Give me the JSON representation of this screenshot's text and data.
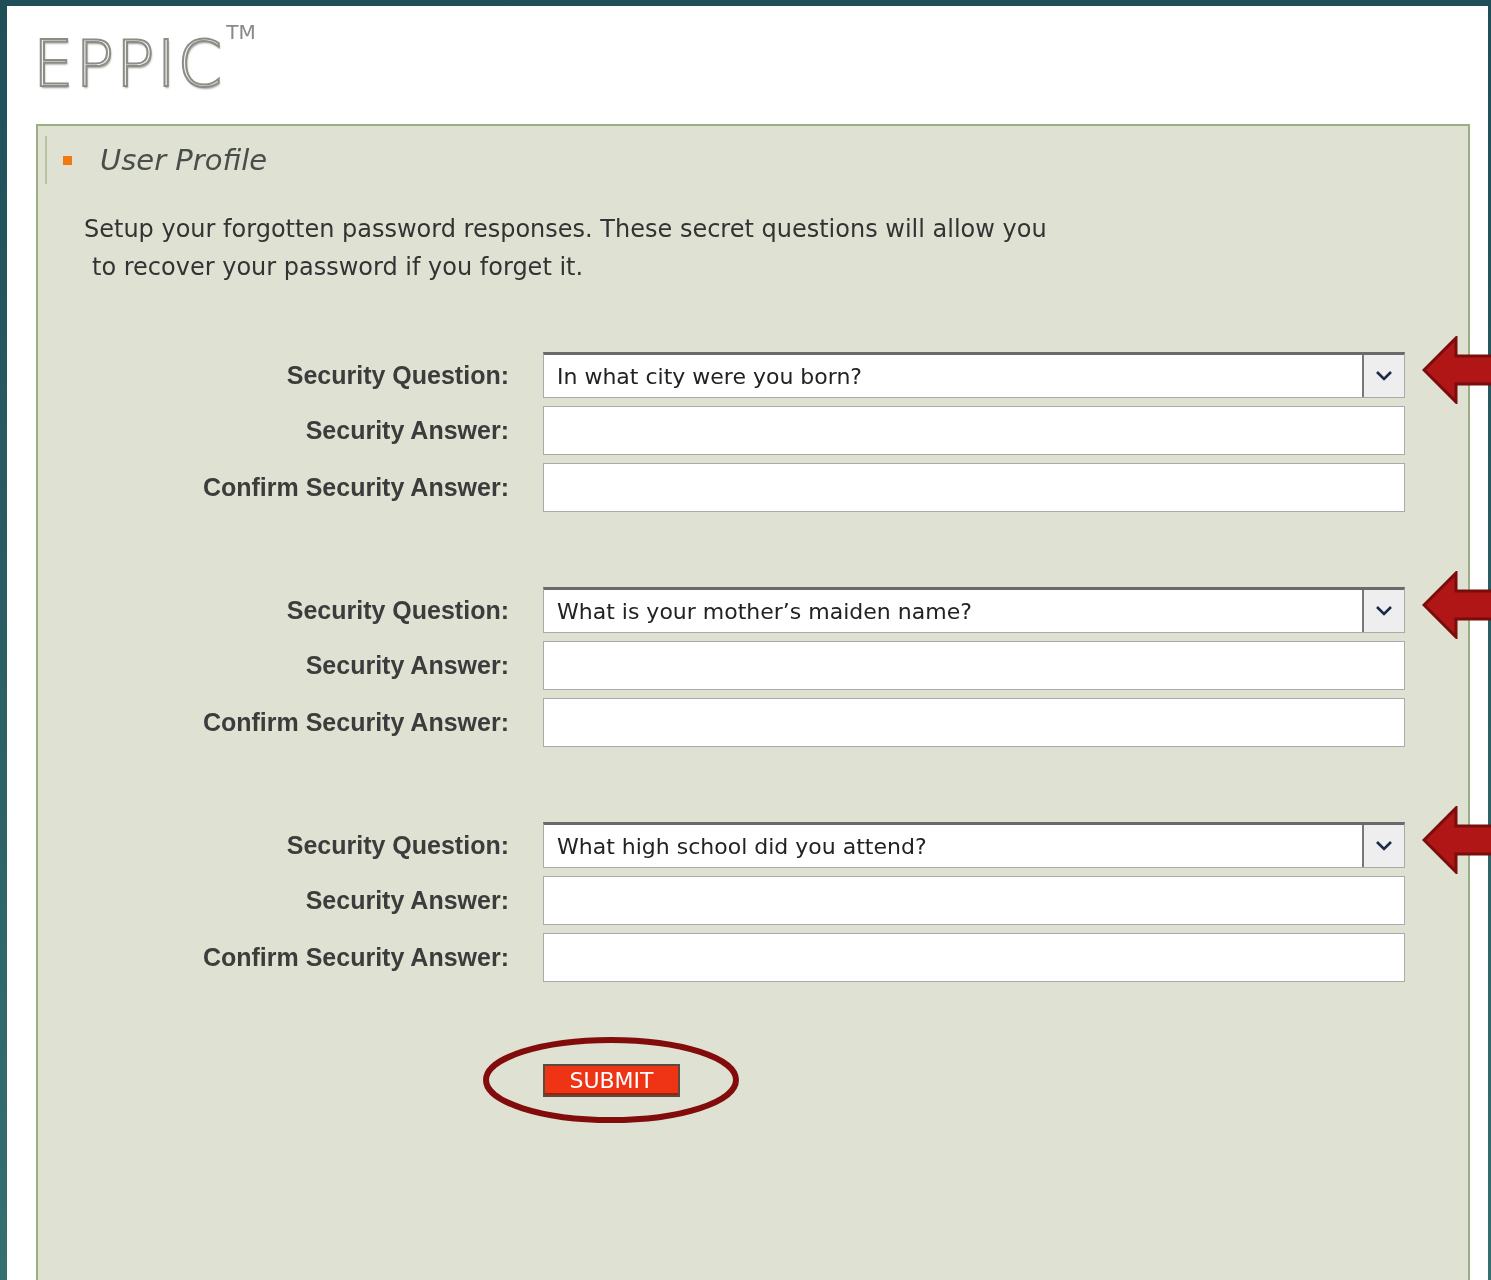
{
  "logo": {
    "text": "EPPIC",
    "mark": "TM"
  },
  "panel": {
    "title": "User Profile",
    "description": [
      "Setup your forgotten password responses. These secret questions will allow you",
      "to recover your password if you forget it."
    ]
  },
  "groups": [
    {
      "question_label": "Security Question:",
      "question": "In what city were you born?",
      "answer_label": "Security Answer:",
      "confirm_label": "Confirm Security Answer:",
      "highlighted": true
    },
    {
      "question_label": "Security Question:",
      "question": "What is your mother’s maiden name?",
      "answer_label": "Security Answer:",
      "confirm_label": "Confirm Security Answer:",
      "highlighted": true
    },
    {
      "question_label": "Security Question:",
      "question": "What high school did you attend?",
      "answer_label": "Security Answer:",
      "confirm_label": "Confirm Security Answer:",
      "highlighted": true
    }
  ],
  "submit": {
    "label": "SUBMIT",
    "circled": true
  }
}
